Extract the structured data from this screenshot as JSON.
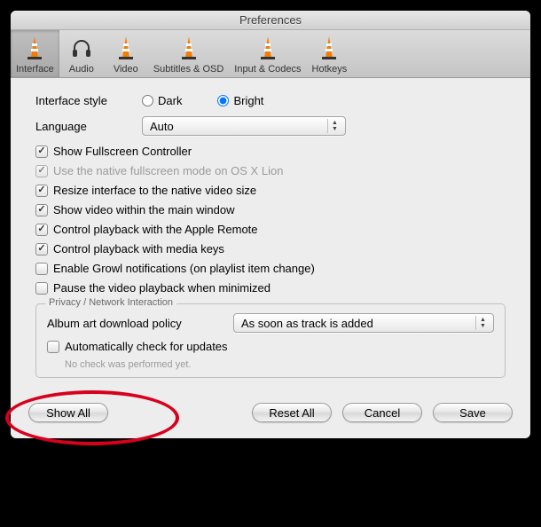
{
  "window": {
    "title": "Preferences"
  },
  "toolbar": {
    "items": [
      {
        "label": "Interface"
      },
      {
        "label": "Audio"
      },
      {
        "label": "Video"
      },
      {
        "label": "Subtitles & OSD"
      },
      {
        "label": "Input & Codecs"
      },
      {
        "label": "Hotkeys"
      }
    ]
  },
  "form": {
    "interface_style_label": "Interface style",
    "radio_dark": "Dark",
    "radio_bright": "Bright",
    "language_label": "Language",
    "language_value": "Auto"
  },
  "checks": {
    "c0": "Show Fullscreen Controller",
    "c1": "Use the native fullscreen mode on OS X Lion",
    "c2": "Resize interface to the native video size",
    "c3": "Show video within the main window",
    "c4": "Control playback with the Apple Remote",
    "c5": "Control playback with media keys",
    "c6": "Enable Growl notifications (on playlist item change)",
    "c7": "Pause the video playback when minimized"
  },
  "privacy": {
    "title": "Privacy / Network Interaction",
    "album_label": "Album art download policy",
    "album_value": "As soon as track is added",
    "auto_update": "Automatically check for updates",
    "hint": "No check was performed yet."
  },
  "buttons": {
    "show_all": "Show All",
    "reset_all": "Reset All",
    "cancel": "Cancel",
    "save": "Save"
  }
}
